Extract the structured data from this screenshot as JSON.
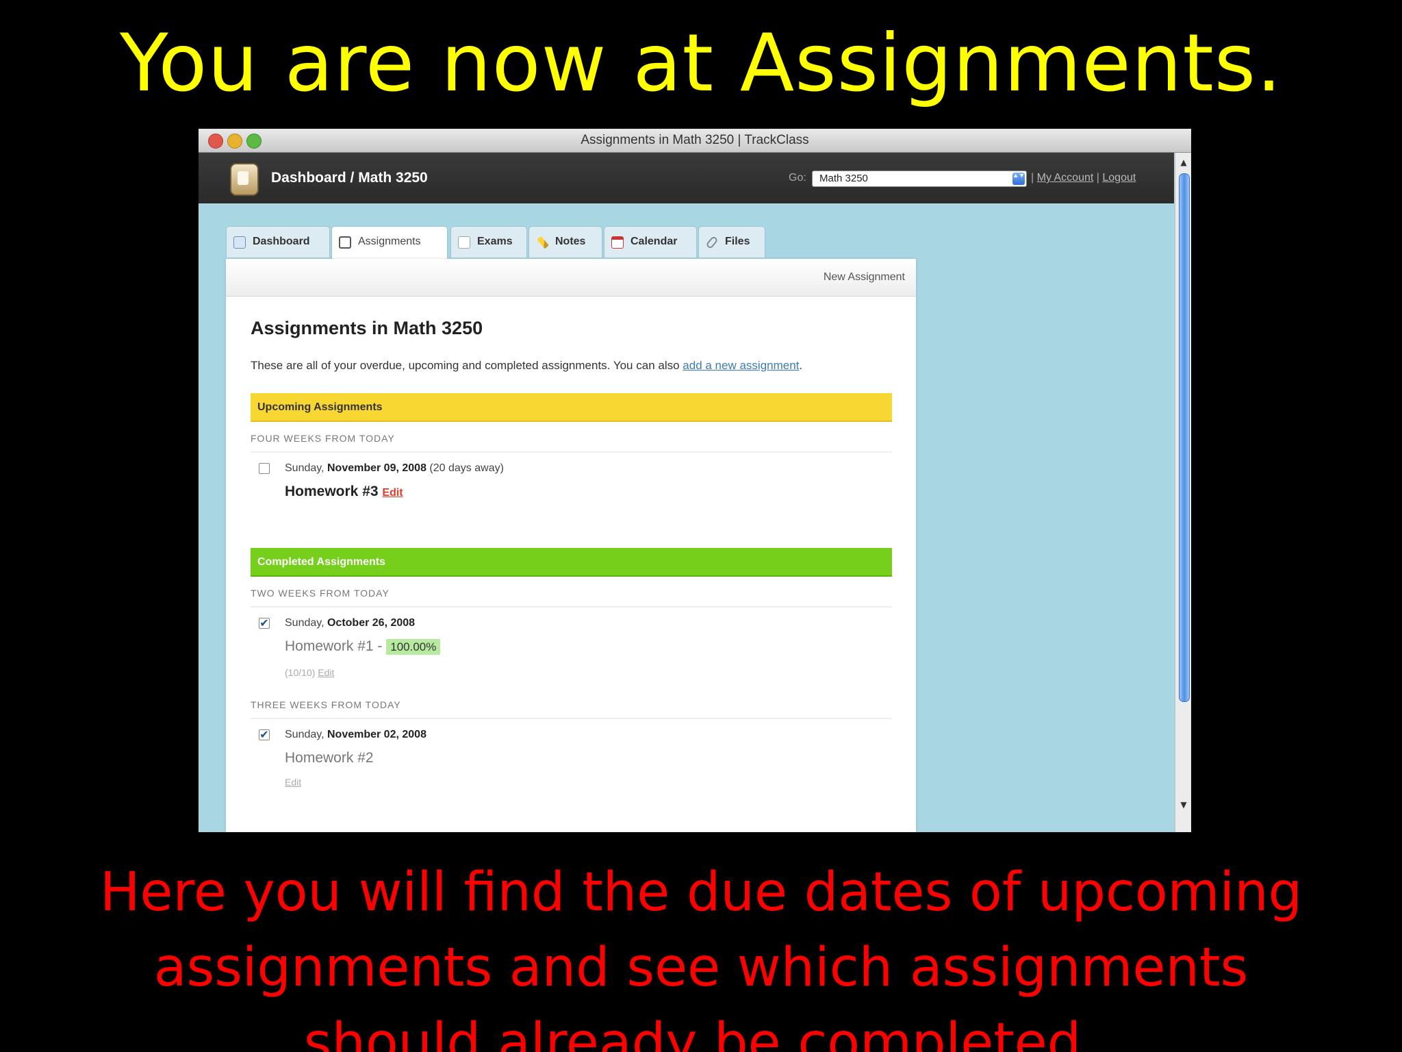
{
  "slide": {
    "title": "You are now at Assignments.",
    "caption_lines": [
      "Here you will find the due dates of upcoming",
      "assignments and see which assignments",
      "should already be completed."
    ]
  },
  "window": {
    "title": "Assignments in Math 3250 | TrackClass"
  },
  "appbar": {
    "breadcrumb": "Dashboard / Math 3250",
    "go_label": "Go:",
    "go_value": "Math 3250",
    "separator": "|",
    "my_account": "My Account",
    "logout": "Logout"
  },
  "tabs": [
    {
      "label": "Dashboard"
    },
    {
      "label": "Assignments"
    },
    {
      "label": "Exams"
    },
    {
      "label": "Notes"
    },
    {
      "label": "Calendar"
    },
    {
      "label": "Files"
    }
  ],
  "panel": {
    "new_assignment": "New Assignment",
    "title": "Assignments in Math 3250",
    "intro_text": "These are all of your overdue, upcoming and completed assignments. You can also",
    "intro_link": "add a new assignment",
    "intro_end": "."
  },
  "upcoming": {
    "heading": "Upcoming Assignments",
    "group_label": "FOUR WEEKS FROM TODAY",
    "item": {
      "weekday": "Sunday,",
      "date": "November 09, 2008",
      "away": "(20 days away)",
      "title": "Homework #3",
      "edit": "Edit",
      "checked": false
    }
  },
  "completed": {
    "heading": "Completed Assignments",
    "groups": [
      {
        "label": "TWO WEEKS FROM TODAY",
        "weekday": "Sunday,",
        "date": "October 26, 2008",
        "title": "Homework #1 -",
        "score": "100.00%",
        "points": "(10/10)",
        "edit": "Edit",
        "checked": true
      },
      {
        "label": "THREE WEEKS FROM TODAY",
        "weekday": "Sunday,",
        "date": "November 02, 2008",
        "title": "Homework #2",
        "edit": "Edit",
        "checked": true
      }
    ]
  },
  "icons": {
    "check": "✔",
    "scroll_up": "▲",
    "scroll_down": "▼",
    "select_arrows": "▲▼"
  },
  "colors": {
    "slide_title": "#ffff00",
    "caption": "#ff0000",
    "upcoming_bar": "#f8d733",
    "completed_bar": "#76cf1a",
    "score_bg": "#b7e9a0",
    "edit_red": "#e03a2a"
  }
}
